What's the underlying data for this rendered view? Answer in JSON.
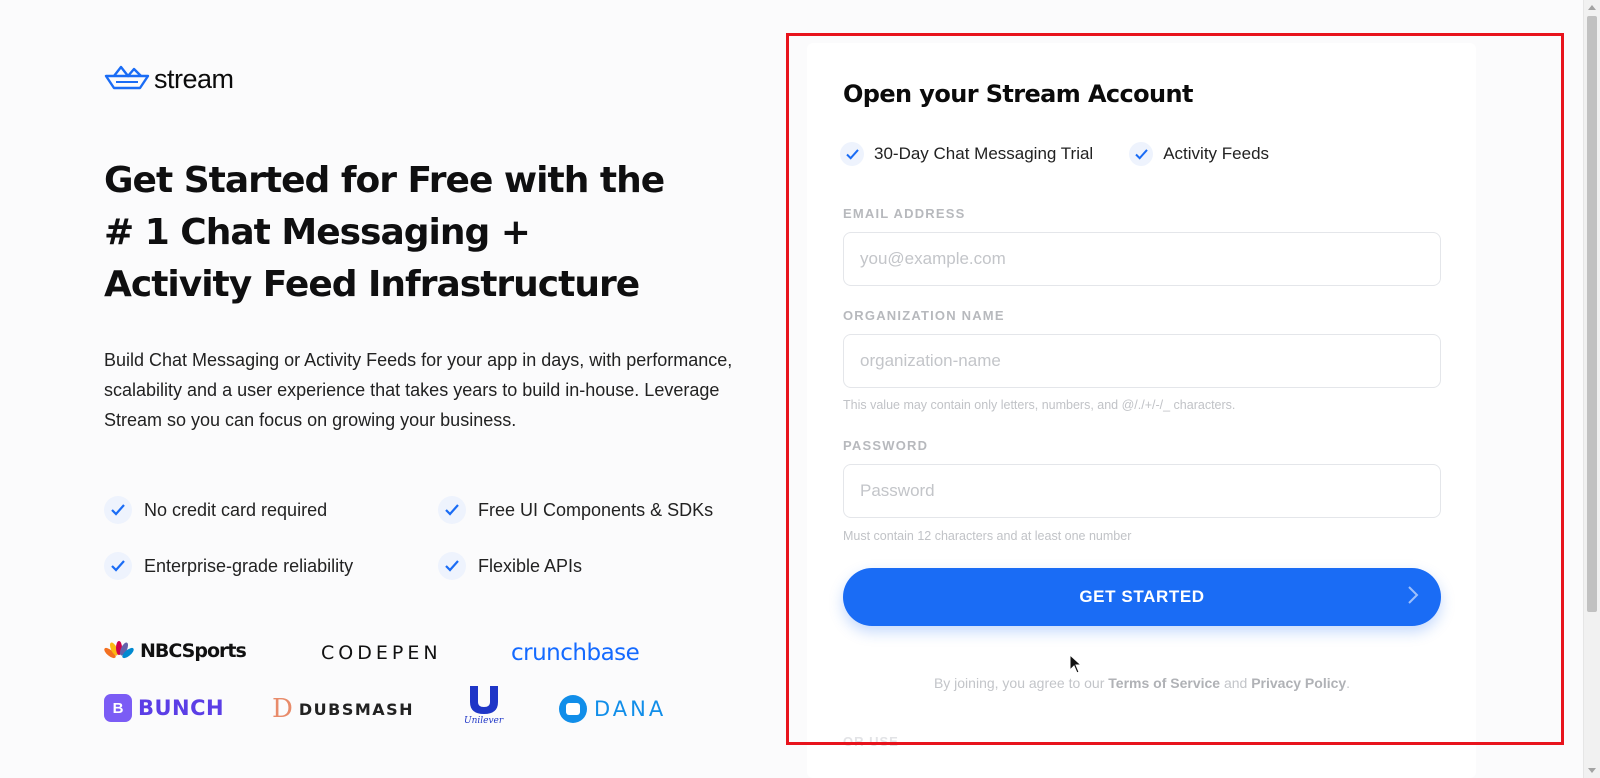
{
  "brand": {
    "logo_text": "stream"
  },
  "hero": {
    "headline_lines": [
      "Get Started for Free with the",
      "# 1 Chat Messaging +",
      "Activity Feed Infrastructure"
    ],
    "description": "Build Chat Messaging or Activity Feeds for your app in days, with performance, scalability and a user experience that takes years to build in-house. Leverage Stream so you can focus on growing your business."
  },
  "features": [
    "No credit card required",
    "Free UI Components & SDKs",
    "Enterprise-grade reliability",
    "Flexible APIs"
  ],
  "customer_logos": [
    "NBCSports",
    "CODEPEN",
    "crunchbase",
    "BUNCH",
    "DUBSMASH",
    "Unilever",
    "DANA"
  ],
  "signup": {
    "title": "Open your Stream Account",
    "perks": [
      "30-Day Chat Messaging Trial",
      "Activity Feeds"
    ],
    "email": {
      "label": "EMAIL ADDRESS",
      "placeholder": "you@example.com",
      "value": ""
    },
    "organization": {
      "label": "ORGANIZATION NAME",
      "placeholder": "organization-name",
      "value": "",
      "hint": "This value may contain only letters, numbers, and @/./+/-/_ characters."
    },
    "password": {
      "label": "PASSWORD",
      "placeholder": "Password",
      "value": "",
      "hint": "Must contain 12 characters and at least one number"
    },
    "submit_label": "GET STARTED",
    "legal": {
      "prefix": "By joining, you agree to our",
      "terms": "Terms of Service",
      "and": "and",
      "privacy": "Privacy Policy",
      "suffix": "."
    },
    "or_use_label": "OR USE"
  },
  "colors": {
    "accent": "#1a6cf5",
    "highlight_border": "#e8131c",
    "background": "#fbfbfc"
  }
}
